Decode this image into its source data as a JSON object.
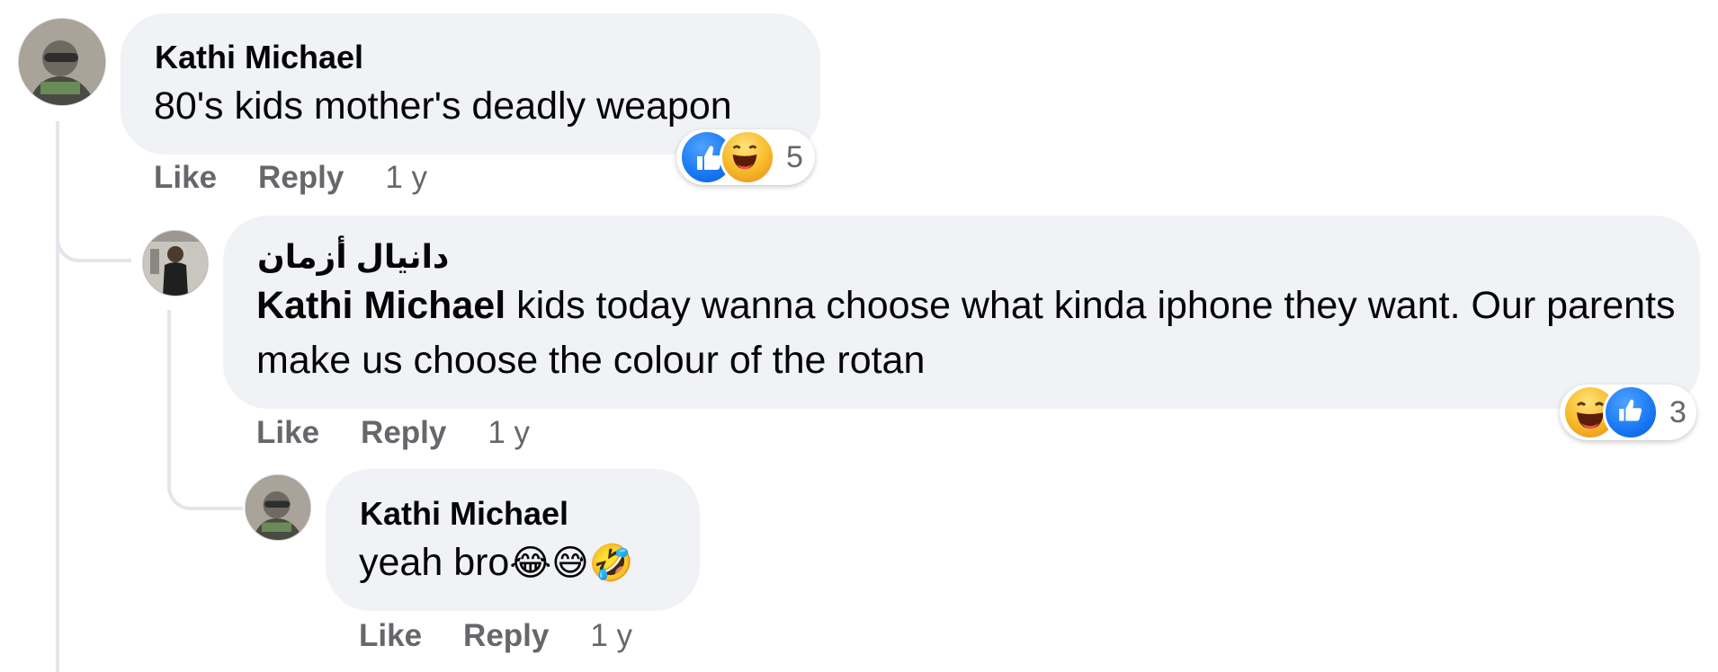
{
  "comments": [
    {
      "author": "Kathi Michael",
      "text": "80's kids mother's deadly weapon",
      "actions": {
        "like": "Like",
        "reply": "Reply",
        "time": "1 y"
      },
      "reaction_count": "5"
    },
    {
      "author": "دانيال أزمان",
      "mention": "Kathi Michael",
      "text": " kids today wanna choose what kinda iphone they want. Our parents make us choose the colour of the rotan",
      "actions": {
        "like": "Like",
        "reply": "Reply",
        "time": "1 y"
      },
      "reaction_count": "3"
    },
    {
      "author": "Kathi Michael",
      "text": "yeah bro",
      "emojis": "😂😅🤣",
      "actions": {
        "like": "Like",
        "reply": "Reply",
        "time": "1 y"
      }
    }
  ],
  "icons": {
    "like_reaction": "thumbs-up-icon",
    "haha_reaction": "laughing-face-icon"
  },
  "colors": {
    "bubble": "#f0f2f5",
    "text": "#050505",
    "secondary_text": "#65676b",
    "like_blue": "#1877f2",
    "haha_yellow": "#f7b928",
    "thread_line": "#e4e6eb"
  }
}
